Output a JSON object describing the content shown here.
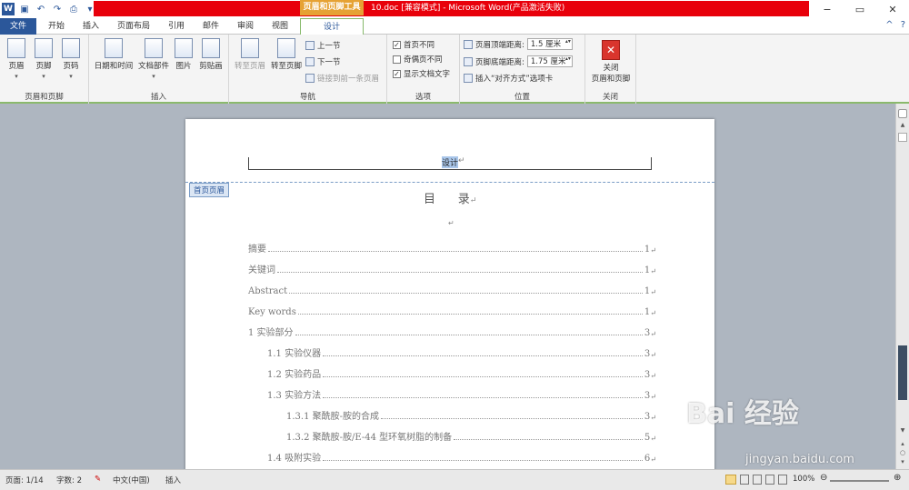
{
  "window": {
    "context_tool": "页眉和页脚工具",
    "doc_title": "10.doc [兼容模式] - Microsoft Word(产品激活失败)",
    "controls": [
      "−",
      "▭",
      "✕"
    ]
  },
  "qat": {
    "icons": [
      "word-icon",
      "save-icon",
      "undo-icon",
      "redo-icon",
      "print-icon",
      "customize-icon"
    ],
    "word_glyph": "W"
  },
  "tabs": [
    "文件",
    "开始",
    "插入",
    "页面布局",
    "引用",
    "邮件",
    "审阅",
    "视图",
    "设计"
  ],
  "ribbon": {
    "groups": {
      "header_footer": {
        "label": "页眉和页脚",
        "header": "页眉",
        "footer": "页脚",
        "page_num": "页码"
      },
      "insert": {
        "label": "插入",
        "datetime": "日期和时间",
        "docparts": "文档部件",
        "picture": "图片",
        "clipart": "剪贴画"
      },
      "nav": {
        "label": "导航",
        "goto_header": "转至页眉",
        "goto_footer": "转至页脚",
        "prev": "上一节",
        "next": "下一节",
        "link_prev": "链接到前一条页眉"
      },
      "options": {
        "label": "选项",
        "diff_first": "首页不同",
        "diff_odd_even": "奇偶页不同",
        "show_text": "显示文档文字",
        "diff_first_checked": true,
        "diff_odd_even_checked": false,
        "show_text_checked": true
      },
      "position": {
        "label": "位置",
        "header_dist_label": "页眉顶端距离:",
        "header_dist": "1.5 厘米",
        "footer_dist_label": "页脚底端距离:",
        "footer_dist": "1.75 厘米",
        "insert_align": "插入“对齐方式”选项卡"
      },
      "close": {
        "label": "关闭",
        "btn1": "关闭",
        "btn2": "页眉和页脚"
      }
    },
    "minimize_icon": "^",
    "help_icon": "?"
  },
  "document": {
    "header_text": "设计",
    "para_mark": "↵",
    "header_tag": "首页页眉",
    "toc_title": "目      录",
    "toc": [
      {
        "text": "摘要",
        "page": "1",
        "level": 0
      },
      {
        "text": "关键词",
        "page": "1",
        "level": 0
      },
      {
        "text": "Abstract",
        "page": "1",
        "level": 0
      },
      {
        "text": "Key words",
        "page": "1",
        "level": 0
      },
      {
        "text": "1  实验部分",
        "page": "3",
        "level": 0
      },
      {
        "text": "1.1  实验仪器",
        "page": "3",
        "level": 1
      },
      {
        "text": "1.2  实验药品",
        "page": "3",
        "level": 1
      },
      {
        "text": "1.3  实验方法",
        "page": "3",
        "level": 1
      },
      {
        "text": "1.3.1  聚酰胺-胺的合成",
        "page": "3",
        "level": 2
      },
      {
        "text": "1.3.2  聚酰胺-胺/E-44 型环氧树脂的制备",
        "page": "5",
        "level": 2
      },
      {
        "text": "1.4  吸附实验",
        "page": "6",
        "level": 1
      }
    ]
  },
  "status": {
    "page": "页面: 1/14",
    "words": "字数: 2",
    "lang": "中文(中国)",
    "mode": "插入",
    "zoom": "100%"
  },
  "watermark": {
    "brand": "Bai   经验",
    "url": "jingyan.baidu.com"
  }
}
